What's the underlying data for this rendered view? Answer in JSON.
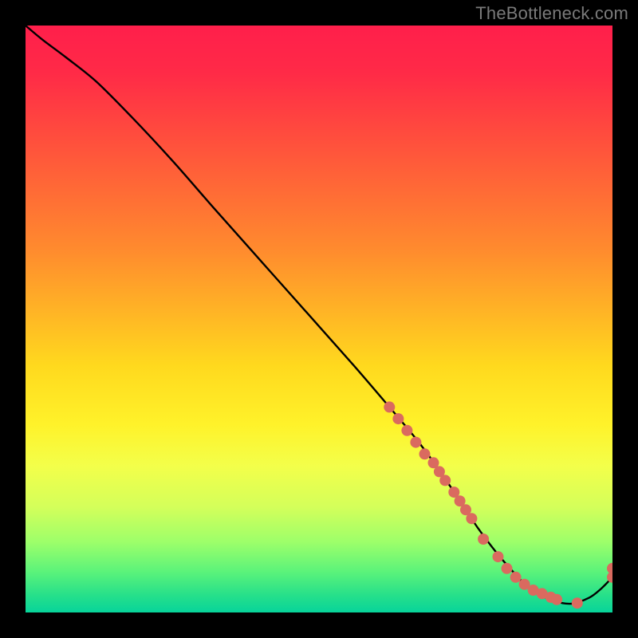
{
  "watermark": "TheBottleneck.com",
  "colors": {
    "background": "#000000",
    "curve": "#000000",
    "marker": "#da6a5f",
    "gradient_top": "#ff1f4b",
    "gradient_bottom": "#07d49a"
  },
  "chart_data": {
    "type": "line",
    "title": "",
    "xlabel": "",
    "ylabel": "",
    "xlim": [
      0,
      100
    ],
    "ylim": [
      0,
      100
    ],
    "x": [
      0,
      3,
      7,
      12,
      18,
      25,
      32,
      40,
      48,
      56,
      62,
      67,
      71,
      74,
      77,
      80,
      83,
      86,
      90,
      93,
      96,
      98,
      100
    ],
    "y": [
      100,
      97.5,
      94.5,
      90.5,
      84.5,
      77,
      69,
      60,
      51,
      42,
      35,
      29,
      23.5,
      19,
      14.5,
      10.5,
      7,
      4,
      2,
      1.5,
      2.5,
      4,
      6
    ],
    "markers": {
      "x": [
        62,
        63.5,
        65,
        66.5,
        68,
        69.5,
        70.5,
        71.5,
        73,
        74,
        75,
        76,
        78,
        80.5,
        82,
        83.5,
        85,
        86.5,
        88,
        89.5,
        90.5,
        94,
        100,
        100
      ],
      "y": [
        35,
        33,
        31,
        29,
        27,
        25.5,
        24,
        22.5,
        20.5,
        19,
        17.5,
        16,
        12.5,
        9.5,
        7.5,
        6,
        4.8,
        3.8,
        3.2,
        2.6,
        2.2,
        1.6,
        6,
        7.5
      ]
    }
  }
}
